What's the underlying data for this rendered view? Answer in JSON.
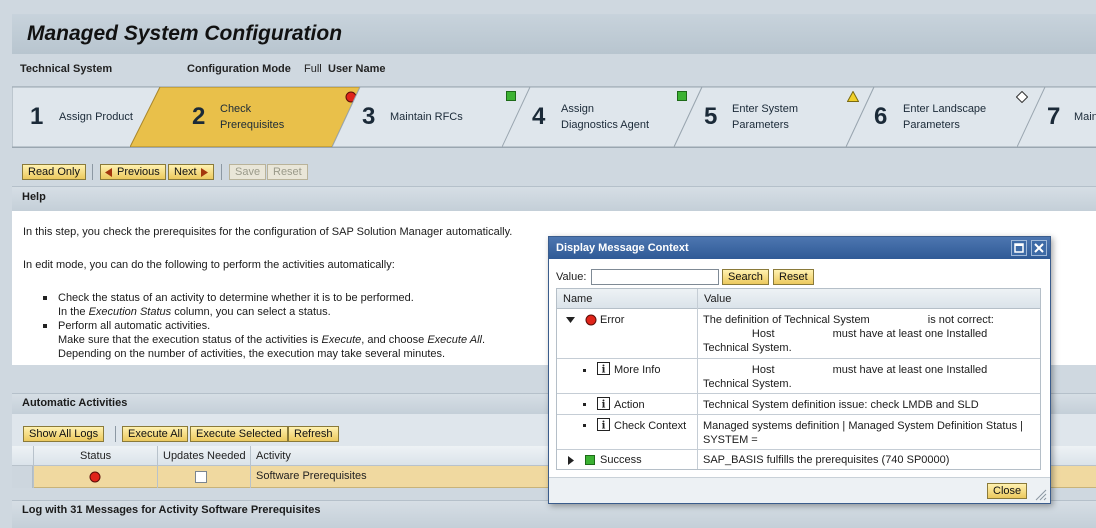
{
  "page": {
    "title": "Managed System Configuration"
  },
  "info": {
    "technical_system": "Technical System",
    "config_mode_label": "Configuration Mode",
    "config_mode_value": "Full",
    "user_name": "User Name"
  },
  "roadmap": {
    "steps": [
      {
        "num": "1",
        "label1": "Assign Product",
        "label2": "",
        "status": "green"
      },
      {
        "num": "2",
        "label1": "Check",
        "label2": "Prerequisites",
        "status": "error"
      },
      {
        "num": "3",
        "label1": "Maintain RFCs",
        "label2": "",
        "status": "green"
      },
      {
        "num": "4",
        "label1": "Assign",
        "label2": "Diagnostics Agent",
        "status": "green"
      },
      {
        "num": "5",
        "label1": "Enter System",
        "label2": "Parameters",
        "status": "green"
      },
      {
        "num": "6",
        "label1": "Enter Landscape",
        "label2": "Parameters",
        "status": "warning"
      },
      {
        "num": "7",
        "label1": "Main",
        "label2": "",
        "status": "diamond"
      }
    ]
  },
  "toolbar": {
    "read_only": "Read Only",
    "previous": "Previous",
    "next": "Next",
    "save": "Save",
    "reset": "Reset"
  },
  "help": {
    "header": "Help",
    "p1": "In this step, you check the prerequisites for the configuration of SAP Solution Manager automatically.",
    "p2": "In edit mode, you can do the following to perform the activities automatically:",
    "b1": "Check the status of an activity to determine whether it is to be performed.",
    "b1a_pre": "In the ",
    "b1a_em": "Execution Status",
    "b1a_post": " column, you can select a status.",
    "b2": "Perform all automatic activities.",
    "b2a_pre": "Make sure that the execution status of the activities is ",
    "b2a_em1": "Execute",
    "b2a_mid": ", and choose ",
    "b2a_em2": "Execute All",
    "b2a_post": ".",
    "b2b": "Depending on the number of activities, the execution may take several minutes."
  },
  "activities": {
    "header": "Automatic Activities",
    "show_all_logs": "Show All Logs",
    "execute_all": "Execute All",
    "execute_selected": "Execute Selected",
    "refresh": "Refresh",
    "columns": [
      "Status",
      "Updates Needed",
      "Activity"
    ],
    "rows": [
      {
        "status": "error",
        "updates_needed": false,
        "activity": "Software Prerequisites"
      }
    ]
  },
  "log": {
    "header": "Log with 31 Messages for Activity Software Prerequisites"
  },
  "dialog": {
    "title": "Display Message Context",
    "value_label": "Value:",
    "value": "",
    "search": "Search",
    "reset": "Reset",
    "col_name": "Name",
    "col_value": "Value",
    "rows": [
      {
        "name": "Error",
        "value": "The definition of Technical System                   is not correct:\n                Host                   must have at least one Installed\nTechnical System."
      },
      {
        "name": "More Info",
        "value": "                Host                   must have at least one Installed\nTechnical System."
      },
      {
        "name": "Action",
        "value": "Technical System definition issue: check LMDB and SLD"
      },
      {
        "name": "Check Context",
        "value": "Managed systems definition | Managed System Definition Status |\nSYSTEM ="
      },
      {
        "name": "Success",
        "value": "SAP_BASIS fulfills the prerequisites (740 SP0000)"
      }
    ],
    "close": "Close"
  },
  "colors": {
    "accent_yellow": "#e6c24a",
    "header_blue": "#2f5a96",
    "selected_row": "#f0d9a0"
  }
}
